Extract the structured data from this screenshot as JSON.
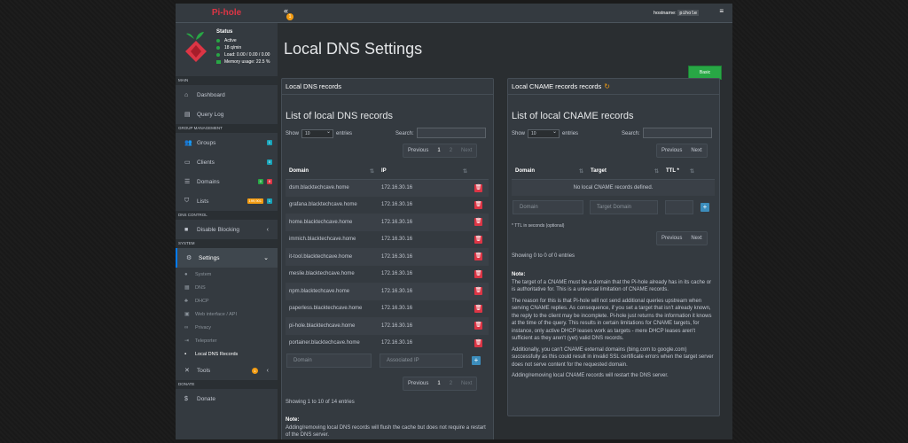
{
  "brand": "Pi-hole",
  "status": {
    "title": "Status",
    "lines": [
      "Active",
      "18 q/min",
      "Load: 0.00 / 0.00 / 0.00",
      "Memory usage: 22.5 %"
    ]
  },
  "sidebar": {
    "sections": {
      "main": "MAIN",
      "group": "GROUP MANAGEMENT",
      "dns": "DNS CONTROL",
      "system": "SYSTEM",
      "donate": "DONATE"
    },
    "dashboard": "Dashboard",
    "querylog": "Query Log",
    "groups": "Groups",
    "groups_badge": "1",
    "clients": "Clients",
    "clients_badge": "0",
    "domains": "Domains",
    "domains_badge_a": "0",
    "domains_badge_b": "8",
    "lists": "Lists",
    "lists_badge_a": "199,901",
    "lists_badge_b": "1",
    "disable_blocking": "Disable Blocking",
    "settings": "Settings",
    "sub": [
      "System",
      "DNS",
      "DHCP",
      "Web interface / API",
      "Privacy",
      "Teleporter",
      "Local DNS Records"
    ],
    "tools": "Tools",
    "tools_badge": "1",
    "donate": "Donate"
  },
  "topbar": {
    "hostname_label": "hostname:",
    "hostname": "pihole",
    "notif_count": "1"
  },
  "page": {
    "title": "Local DNS Settings",
    "basic_button": "Basic"
  },
  "dns_card": {
    "header": "Local DNS records",
    "list_title": "List of local DNS records",
    "show": "Show",
    "entries_value": "10",
    "entries": "entries",
    "search_label": "Search:",
    "pager": {
      "prev": "Previous",
      "p1": "1",
      "p2": "2",
      "next": "Next"
    },
    "columns": [
      "Domain",
      "IP"
    ],
    "rows": [
      {
        "domain": "dsm.blacktechcave.home",
        "ip": "172.16.30.16"
      },
      {
        "domain": "grafana.blacktechcave.home",
        "ip": "172.16.30.16"
      },
      {
        "domain": "home.blacktechcave.home",
        "ip": "172.16.30.16"
      },
      {
        "domain": "immich.blacktechcave.home",
        "ip": "172.16.30.16"
      },
      {
        "domain": "it-tool.blacktechcave.home",
        "ip": "172.16.30.16"
      },
      {
        "domain": "meslie.blacktechcave.home",
        "ip": "172.16.30.16"
      },
      {
        "domain": "npm.blacktechcave.home",
        "ip": "172.16.30.16"
      },
      {
        "domain": "paperless.blacktechcave.home",
        "ip": "172.16.30.16"
      },
      {
        "domain": "pi-hole.blacktechcave.home",
        "ip": "172.16.30.16"
      },
      {
        "domain": "portainer.blacktechcave.home",
        "ip": "172.16.30.16"
      }
    ],
    "domain_placeholder": "Domain",
    "ip_placeholder": "Associated IP",
    "showing": "Showing 1 to 10 of 14 entries",
    "note_title": "Note:",
    "note_text": "Adding/removing local DNS records will flush the cache but does not require a restart of the DNS server."
  },
  "cname_card": {
    "header": "Local CNAME records records",
    "list_title": "List of local CNAME records",
    "show": "Show",
    "entries_value": "10",
    "entries": "entries",
    "search_label": "Search:",
    "pager": {
      "prev": "Previous",
      "next": "Next"
    },
    "columns": [
      "Domain",
      "Target",
      "TTL *"
    ],
    "empty": "No local CNAME records defined.",
    "domain_placeholder": "Domain",
    "target_placeholder": "Target Domain",
    "ttl_note": "* TTL in seconds (optional)",
    "showing": "Showing 0 to 0 of 0 entries",
    "note_title": "Note:",
    "note_p1": "The target of a CNAME must be a domain that the Pi-hole already has in its cache or is authoritative for. This is a universal limitation of CNAME records.",
    "note_p2": "The reason for this is that Pi-hole will not send additional queries upstream when serving CNAME replies. As consequence, if you set a target that isn't already known, the reply to the client may be incomplete. Pi-hole just returns the information it knows at the time of the query. This results in certain limitations for CNAME targets, for instance, only active DHCP leases work as targets - mere DHCP leases aren't sufficient as they aren't (yet) valid DNS records.",
    "note_p3": "Additionally, you can't CNAME external domains (bing.com to google.com) successfully as this could result in invalid SSL certificate errors when the target server does not serve content for the requested domain.",
    "note_p4": "Adding/removing local CNAME records will restart the DNS server."
  }
}
